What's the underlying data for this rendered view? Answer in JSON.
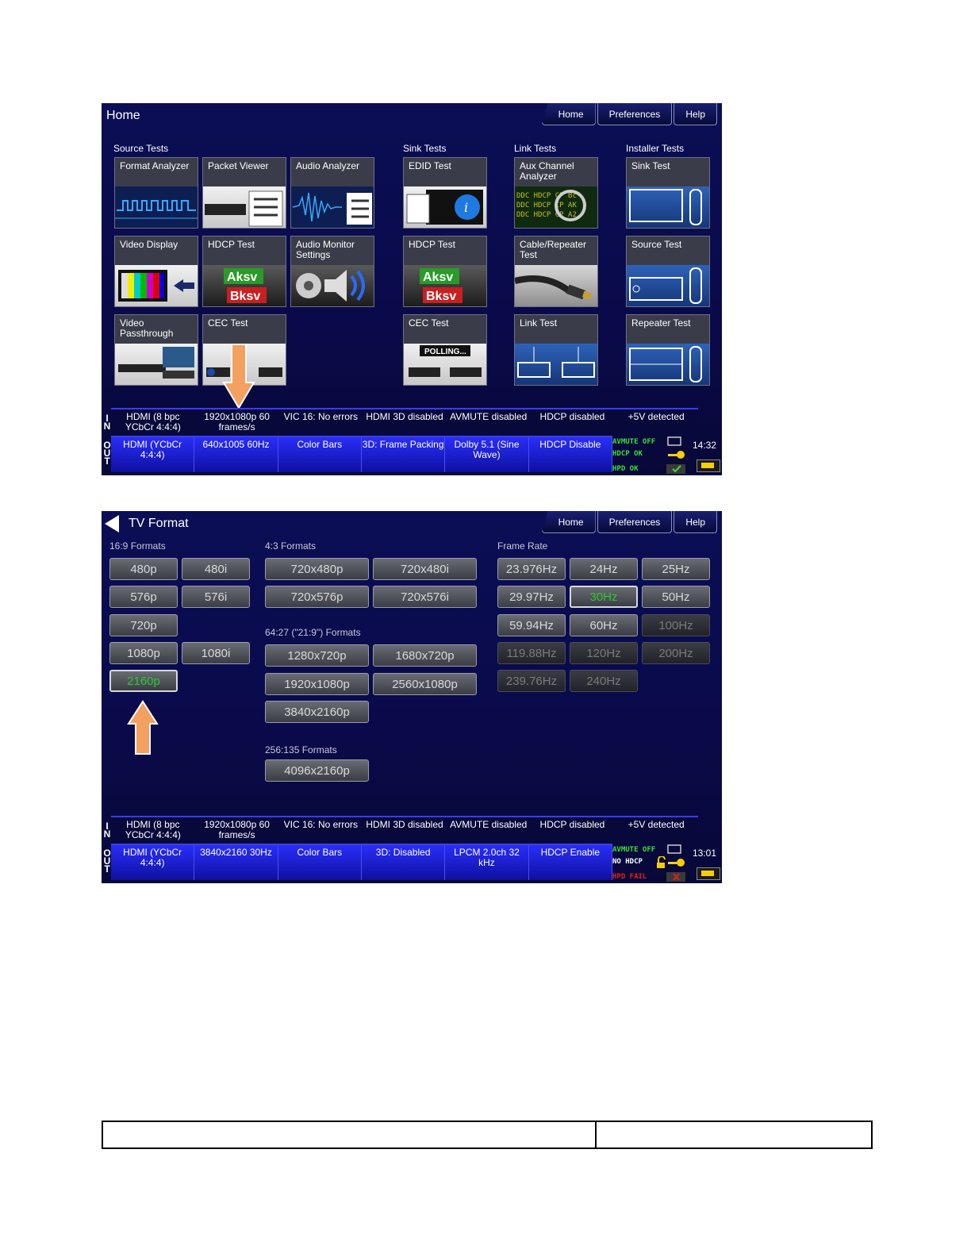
{
  "screen1": {
    "title": "Home",
    "nav": [
      "Home",
      "Preferences",
      "Help"
    ],
    "sections": [
      "Source Tests",
      "Sink Tests",
      "Link Tests",
      "Installer Tests"
    ],
    "tiles": [
      {
        "label": "Format Analyzer"
      },
      {
        "label": "Packet Viewer"
      },
      {
        "label": "Audio Analyzer"
      },
      {
        "label": "EDID Test"
      },
      {
        "label": "Aux Channel Analyzer"
      },
      {
        "label": "Sink Test"
      },
      {
        "label": "Video Display"
      },
      {
        "label": "HDCP Test"
      },
      {
        "label": "Audio Monitor Settings"
      },
      {
        "label": "HDCP Test"
      },
      {
        "label": "Cable/Repeater Test"
      },
      {
        "label": "Source Test"
      },
      {
        "label": "Video Passthrough"
      },
      {
        "label": "CEC Test"
      },
      {
        "label": "CEC Test"
      },
      {
        "label": "Link Test"
      },
      {
        "label": "Repeater Test"
      }
    ],
    "in_status": [
      "HDMI (8 bpc YCbCr 4:4:4)",
      "1920x1080p 60 frames/s",
      "VIC 16: No errors",
      "HDMI 3D disabled",
      "AVMUTE disabled",
      "HDCP disabled",
      "+5V detected"
    ],
    "out_status": [
      "HDMI (YCbCr 4:4:4)",
      "640x1005 60Hz",
      "Color Bars",
      "3D: Frame Packing",
      "Dolby 5.1 (Sine Wave)",
      "HDCP Disable"
    ],
    "indicators": {
      "avmute": "AVMUTE OFF",
      "hdcp": "HDCP OK",
      "hpd": "HPD OK"
    },
    "time": "14:32"
  },
  "screen2": {
    "title": "TV Format",
    "nav": [
      "Home",
      "Preferences",
      "Help"
    ],
    "labels": {
      "f169": "16:9 Formats",
      "f43": "4:3 Formats",
      "f6427": "64:27 (\"21:9\") Formats",
      "f256": "256:135 Formats",
      "rate": "Frame Rate"
    },
    "formats169": [
      "480p",
      "480i",
      "576p",
      "576i",
      "720p",
      "1080p",
      "1080i",
      "2160p"
    ],
    "formats43": [
      "720x480p",
      "720x480i",
      "720x576p",
      "720x576i"
    ],
    "formats6427": [
      "1280x720p",
      "1680x720p",
      "1920x1080p",
      "2560x1080p",
      "3840x2160p"
    ],
    "formats256": [
      "4096x2160p"
    ],
    "rates": [
      "23.976Hz",
      "24Hz",
      "25Hz",
      "29.97Hz",
      "30Hz",
      "50Hz",
      "59.94Hz",
      "60Hz",
      "100Hz",
      "119.88Hz",
      "120Hz",
      "200Hz",
      "239.76Hz",
      "240Hz"
    ],
    "in_status": [
      "HDMI (8 bpc YCbCr 4:4:4)",
      "1920x1080p 60 frames/s",
      "VIC 16: No errors",
      "HDMI 3D disabled",
      "AVMUTE disabled",
      "HDCP disabled",
      "+5V detected"
    ],
    "out_status": [
      "HDMI (YCbCr 4:4:4)",
      "3840x2160 30Hz",
      "Color Bars",
      "3D: Disabled",
      "LPCM 2.0ch 32 kHz",
      "HDCP Enable"
    ],
    "indicators": {
      "avmute": "AVMUTE OFF",
      "hdcp": "NO HDCP",
      "hpd": "HPD FAIL"
    },
    "time": "13:01"
  },
  "colors": {
    "selected_text": "#2ec82e",
    "indicator_ok": "#36e036",
    "indicator_fail": "#e02020",
    "arrow": "#f4a060"
  }
}
